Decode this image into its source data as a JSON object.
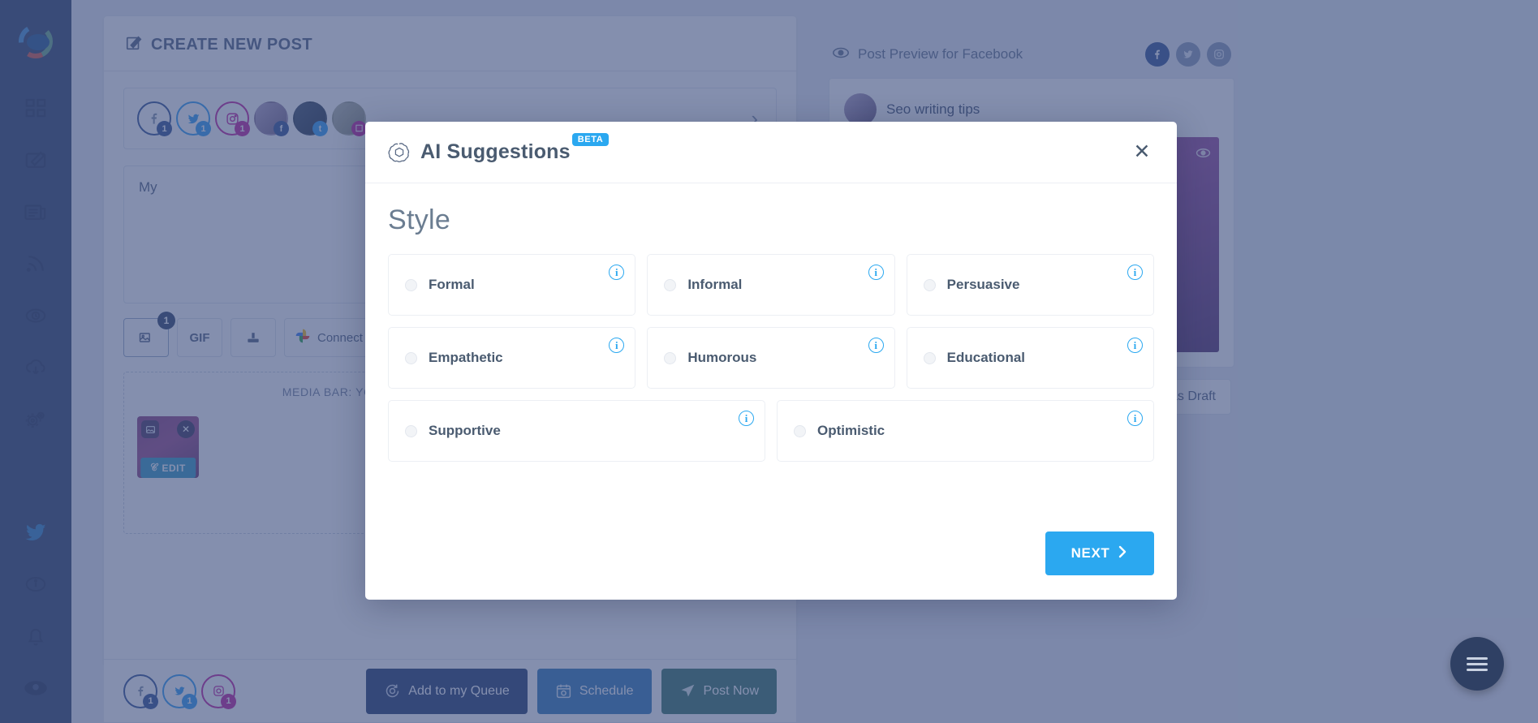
{
  "modal": {
    "title": "AI Suggestions",
    "badge": "BETA",
    "logo_icon": "openai-logo-icon",
    "close_icon": "close-icon",
    "section_title": "Style",
    "info_icon_glyph": "i",
    "next_label": "NEXT",
    "next_chevron": "›",
    "options": [
      [
        {
          "label": "Formal",
          "selected": false,
          "has_info": true
        },
        {
          "label": "Informal",
          "selected": false,
          "has_info": true
        },
        {
          "label": "Persuasive",
          "selected": false,
          "has_info": true
        }
      ],
      [
        {
          "label": "Empathetic",
          "selected": false,
          "has_info": true
        },
        {
          "label": "Humorous",
          "selected": false,
          "has_info": true
        },
        {
          "label": "Educational",
          "selected": false,
          "has_info": true
        }
      ],
      [
        {
          "label": "Supportive",
          "selected": false,
          "has_info": true
        },
        {
          "label": "Optimistic",
          "selected": false,
          "has_info": true
        }
      ]
    ]
  },
  "colors": {
    "accent_blue": "#2ba8f0",
    "overlay": "rgba(56,75,125,0.62)",
    "sidebar": "#3c4d72",
    "text_dark": "#4a5b70",
    "facebook": "#3b5998",
    "twitter": "#38a1f3",
    "instagram": "#c32aa3"
  },
  "sidebar": {
    "logo_icon": "app-logo-icon",
    "items": [
      {
        "icon": "dashboard-grid-icon",
        "name": "dashboard"
      },
      {
        "icon": "compose-pencil-icon",
        "name": "compose"
      },
      {
        "icon": "newspaper-icon",
        "name": "content"
      },
      {
        "icon": "rss-feed-icon",
        "name": "feeds"
      },
      {
        "icon": "history-clock-icon",
        "name": "history"
      },
      {
        "icon": "cloud-download-icon",
        "name": "downloads"
      },
      {
        "icon": "gears-settings-icon",
        "name": "settings"
      }
    ],
    "bottom_items": [
      {
        "icon": "twitter-bird-icon",
        "name": "twitter"
      },
      {
        "icon": "info-circle-icon",
        "name": "info"
      },
      {
        "icon": "bell-icon",
        "name": "notifications"
      },
      {
        "icon": "avatar",
        "name": "user-avatar"
      }
    ]
  },
  "composer": {
    "header_icon": "compose-pencil-icon",
    "header_title": "CREATE NEW POST",
    "accounts_chevron": "›",
    "accounts": [
      {
        "network": "facebook",
        "badge": "1"
      },
      {
        "network": "twitter",
        "badge": "1"
      },
      {
        "network": "instagram",
        "badge": "1"
      },
      {
        "network": "page",
        "mini": "f"
      },
      {
        "network": "profile",
        "mini": "t"
      },
      {
        "network": "profile2",
        "mini": "ig"
      }
    ],
    "editor_text": "My",
    "tools": [
      {
        "label": "",
        "icon": "image-icon",
        "badge": "1",
        "active": true
      },
      {
        "label": "GIF",
        "icon": "gif-icon",
        "active": false
      },
      {
        "label": "",
        "icon": "upload-icon",
        "active": false
      },
      {
        "label": "Connect to Google Photos",
        "icon": "google-photos-icon",
        "active": false
      }
    ],
    "media_bar_hint": "MEDIA BAR: YOU CAN DRAG-N-DROP YOUR MEDIA HERE",
    "thumbnail": {
      "remove_icon": "close-icon",
      "type_icon": "image-icon",
      "edit_label": "EDIT",
      "edit_brand_icon": "canva-icon"
    },
    "footer_accounts": [
      {
        "network": "facebook",
        "badge": "1"
      },
      {
        "network": "twitter",
        "badge": "1"
      },
      {
        "network": "instagram",
        "badge": "1"
      }
    ],
    "footer_buttons": [
      {
        "label": "Add to my Queue",
        "icon": "queue-clock-icon",
        "style": "queue"
      },
      {
        "label": "Schedule",
        "icon": "calendar-clock-icon",
        "style": "sched"
      },
      {
        "label": "Post Now",
        "icon": "send-plane-icon",
        "style": "now"
      }
    ]
  },
  "preview": {
    "eye_icon": "eye-icon",
    "title": "Post Preview for Facebook",
    "networks": [
      {
        "name": "facebook",
        "glyph": "f",
        "active": true
      },
      {
        "name": "twitter",
        "glyph": "t",
        "active": false
      },
      {
        "name": "instagram",
        "glyph": "▢",
        "active": false
      }
    ],
    "post_author": "Seo writing tips",
    "image_eye_icon": "eye-icon",
    "save_draft_label": "Save as Draft"
  },
  "fab": {
    "icon": "hamburger-menu-icon"
  }
}
